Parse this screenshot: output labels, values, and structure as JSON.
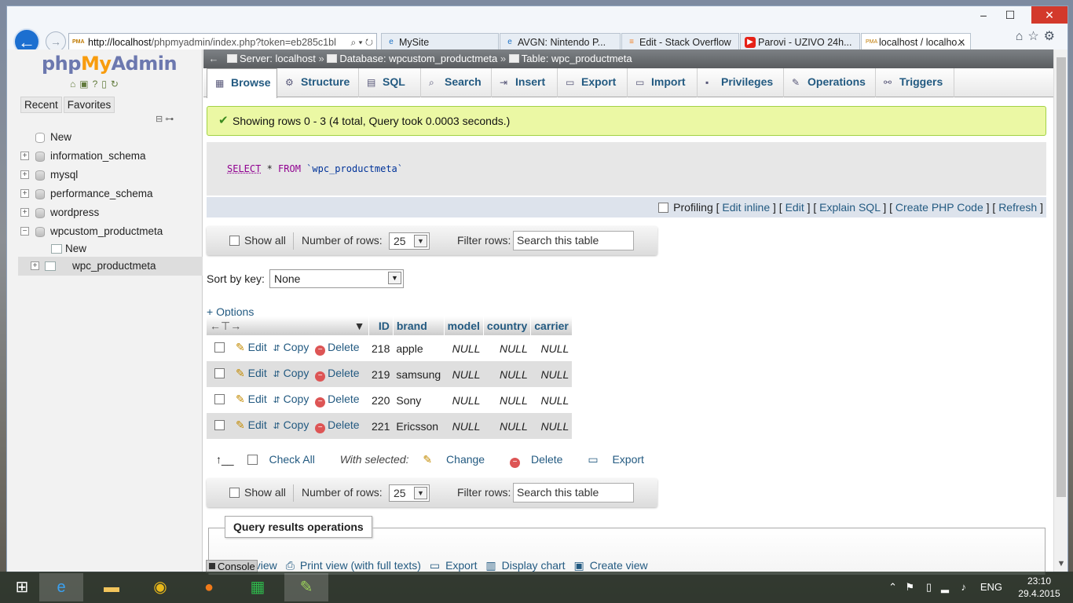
{
  "browser": {
    "url_host": "http://localhost",
    "url_path": "/phpmyadmin/index.php?token=eb285c1bl",
    "tabs": [
      {
        "label": "MySite",
        "icon": "ie-page-icon",
        "active": false
      },
      {
        "label": "AVGN: Nintendo P...",
        "icon": "ie-page-icon",
        "active": false
      },
      {
        "label": "Edit - Stack Overflow",
        "icon": "stackoverflow-icon",
        "active": false
      },
      {
        "label": "Parovi - UZIVO 24h...",
        "icon": "youtube-icon",
        "active": false
      },
      {
        "label": "localhost / localho...",
        "icon": "pma-icon",
        "active": true
      }
    ]
  },
  "pma": {
    "logo_php": "php",
    "logo_my": "My",
    "logo_admin": "Admin",
    "nav_tabs": {
      "recent": "Recent",
      "favorites": "Favorites"
    },
    "tree": {
      "new": "New",
      "databases": [
        "information_schema",
        "mysql",
        "performance_schema",
        "wordpress"
      ],
      "open_db": "wpcustom_productmeta",
      "sub_new": "New",
      "table": "wpc_productmeta"
    },
    "breadcrumb": {
      "server": "Server: localhost",
      "database": "Database: wpcustom_productmeta",
      "table": "Table: wpc_productmeta",
      "sep": "»"
    },
    "menu": [
      "Browse",
      "Structure",
      "SQL",
      "Search",
      "Insert",
      "Export",
      "Import",
      "Privileges",
      "Operations",
      "Triggers"
    ],
    "success": "Showing rows 0 - 3 (4 total, Query took 0.0003 seconds.)",
    "sql": {
      "select": "SELECT",
      "star": " * ",
      "from": "FROM",
      "table": " `wpc_productmeta`"
    },
    "sqlbar": {
      "profiling": "Profiling",
      "edit_inline": "Edit inline",
      "edit": "Edit",
      "explain": "Explain SQL",
      "php": "Create PHP Code",
      "refresh": "Refresh"
    },
    "nav": {
      "show_all": "Show all",
      "num_rows": "Number of rows:",
      "num_value": "25",
      "filter": "Filter rows:",
      "search_placeholder": "Search this table"
    },
    "sort": {
      "label": "Sort by key:",
      "value": "None"
    },
    "options": "+ Options",
    "columns": [
      "ID",
      "brand",
      "model",
      "country",
      "carrier"
    ],
    "row_actions": {
      "edit": "Edit",
      "copy": "Copy",
      "delete": "Delete"
    },
    "rows": [
      {
        "id": "218",
        "brand": "apple",
        "model": "NULL",
        "country": "NULL",
        "carrier": "NULL"
      },
      {
        "id": "219",
        "brand": "samsung",
        "model": "NULL",
        "country": "NULL",
        "carrier": "NULL"
      },
      {
        "id": "220",
        "brand": "Sony",
        "model": "NULL",
        "country": "NULL",
        "carrier": "NULL"
      },
      {
        "id": "221",
        "brand": "Ericsson",
        "model": "NULL",
        "country": "NULL",
        "carrier": "NULL"
      }
    ],
    "bulk": {
      "check_all": "Check All",
      "with_selected": "With selected:",
      "change": "Change",
      "delete": "Delete",
      "export": "Export"
    },
    "qro": {
      "legend": "Query results operations",
      "print_view_part": "t view",
      "print_full": "Print view (with full texts)",
      "export": "Export",
      "chart": "Display chart",
      "create_view": "Create view"
    },
    "console": "Console"
  },
  "taskbar": {
    "lang": "ENG",
    "time": "23:10",
    "date": "29.4.2015"
  }
}
